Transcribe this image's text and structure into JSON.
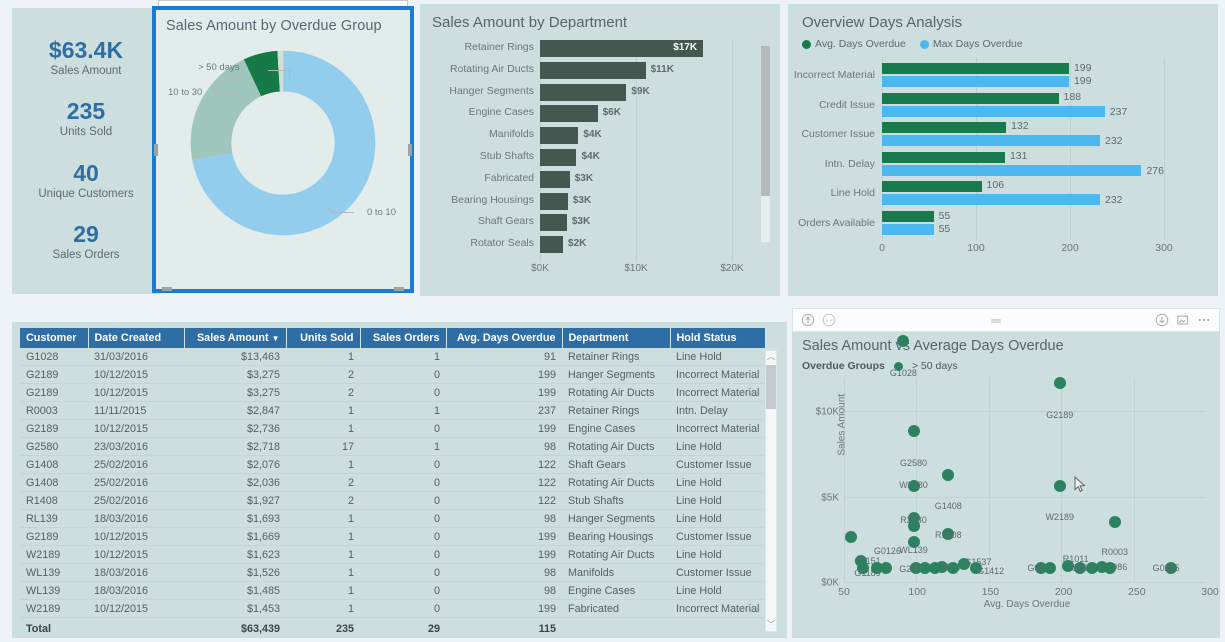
{
  "kpi": {
    "items": [
      {
        "value": "$63.4K",
        "label": "Sales Amount"
      },
      {
        "value": "235",
        "label": "Units Sold"
      },
      {
        "value": "40",
        "label": "Unique Customers"
      },
      {
        "value": "29",
        "label": "Sales Orders"
      }
    ]
  },
  "donut": {
    "title": "Sales Amount by Overdue Group",
    "labels": {
      "gt50": "> 50 days",
      "mid": "10 to 30",
      "low": "0 to 10"
    },
    "selected": true
  },
  "department": {
    "title": "Sales Amount by Department",
    "axis_ticks": [
      "$0K",
      "$10K",
      "$20K"
    ]
  },
  "overview": {
    "title": "Overview Days Analysis",
    "legend": [
      {
        "name": "Avg. Days Overdue",
        "color": "#187a4d"
      },
      {
        "name": "Max Days Overdue",
        "color": "#4bb8ef"
      }
    ],
    "axis_ticks": [
      "0",
      "100",
      "200",
      "300"
    ]
  },
  "table": {
    "columns": [
      "Customer",
      "Date Created",
      "Sales Amount",
      "Units Sold",
      "Sales Orders",
      "Avg. Days Overdue",
      "Department",
      "Hold Status"
    ],
    "sorted_column": "Sales Amount",
    "rows": [
      [
        "G1028",
        "31/03/2016",
        "$13,463",
        "1",
        "1",
        "91",
        "Retainer Rings",
        "Line Hold"
      ],
      [
        "G2189",
        "10/12/2015",
        "$3,275",
        "2",
        "0",
        "199",
        "Hanger Segments",
        "Incorrect Material"
      ],
      [
        "G2189",
        "10/12/2015",
        "$3,275",
        "2",
        "0",
        "199",
        "Rotating Air Ducts",
        "Incorrect Material"
      ],
      [
        "R0003",
        "11/11/2015",
        "$2,847",
        "1",
        "1",
        "237",
        "Retainer Rings",
        "Intn. Delay"
      ],
      [
        "G2189",
        "10/12/2015",
        "$2,736",
        "1",
        "0",
        "199",
        "Engine Cases",
        "Incorrect Material"
      ],
      [
        "G2580",
        "23/03/2016",
        "$2,718",
        "17",
        "1",
        "98",
        "Rotating Air Ducts",
        "Line Hold"
      ],
      [
        "G1408",
        "25/02/2016",
        "$2,076",
        "1",
        "0",
        "122",
        "Shaft Gears",
        "Customer Issue"
      ],
      [
        "G1408",
        "25/02/2016",
        "$2,036",
        "2",
        "0",
        "122",
        "Rotating Air Ducts",
        "Line Hold"
      ],
      [
        "R1408",
        "25/02/2016",
        "$1,927",
        "2",
        "0",
        "122",
        "Stub Shafts",
        "Line Hold"
      ],
      [
        "RL139",
        "18/03/2016",
        "$1,693",
        "1",
        "0",
        "98",
        "Hanger Segments",
        "Line Hold"
      ],
      [
        "G2189",
        "10/12/2015",
        "$1,669",
        "1",
        "0",
        "199",
        "Bearing Housings",
        "Customer Issue"
      ],
      [
        "W2189",
        "10/12/2015",
        "$1,623",
        "1",
        "0",
        "199",
        "Rotating Air Ducts",
        "Line Hold"
      ],
      [
        "WL139",
        "18/03/2016",
        "$1,526",
        "1",
        "0",
        "98",
        "Manifolds",
        "Customer Issue"
      ],
      [
        "WL139",
        "18/03/2016",
        "$1,485",
        "1",
        "0",
        "98",
        "Engine Cases",
        "Line Hold"
      ],
      [
        "W2189",
        "10/12/2015",
        "$1,453",
        "1",
        "0",
        "199",
        "Fabricated",
        "Incorrect Material"
      ]
    ],
    "total_row": [
      "Total",
      "",
      "$63,439",
      "235",
      "29",
      "115",
      "",
      ""
    ]
  },
  "scatter": {
    "title": "Sales Amount vs Average Days Overdue",
    "legend_label": "Overdue Groups",
    "legend_value": "> 50 days"
  },
  "chart_data": [
    {
      "type": "pie",
      "name": "donut-overdue-group",
      "title": "Sales Amount by Overdue Group",
      "categories": [
        "0 to 10",
        "10 to 30",
        "> 50 days"
      ],
      "values": [
        72,
        21,
        7
      ],
      "colors": [
        "#93cdee",
        "#9fc6ba",
        "#157a45"
      ],
      "legend": "labels-outside"
    },
    {
      "type": "bar",
      "name": "sales-amount-by-department",
      "title": "Sales Amount by Department",
      "orientation": "horizontal",
      "categories": [
        "Retainer Rings",
        "Rotating Air Ducts",
        "Hanger Segments",
        "Engine Cases",
        "Manifolds",
        "Stub Shafts",
        "Fabricated",
        "Bearing Housings",
        "Shaft Gears",
        "Rotator Seals"
      ],
      "values": [
        17,
        11,
        9,
        6,
        4,
        4,
        3,
        3,
        3,
        2
      ],
      "value_labels": [
        "$17K",
        "$11K",
        "$9K",
        "$6K",
        "$4K",
        "$4K",
        "$3K",
        "$3K",
        "$3K",
        "$2K"
      ],
      "xlabel": "",
      "ylabel": "",
      "xlim": [
        0,
        20
      ],
      "xtick_labels": [
        "$0K",
        "$10K",
        "$20K"
      ],
      "color": "#43584f",
      "grid": true
    },
    {
      "type": "bar",
      "name": "overview-days-analysis",
      "title": "Overview Days Analysis",
      "orientation": "horizontal",
      "categories": [
        "Incorrect Material",
        "Credit Issue",
        "Customer Issue",
        "Intn. Delay",
        "Line Hold",
        "Orders Available"
      ],
      "series": [
        {
          "name": "Avg. Days Overdue",
          "color": "#187a4d",
          "values": [
            199,
            188,
            132,
            131,
            106,
            55
          ]
        },
        {
          "name": "Max Days Overdue",
          "color": "#4bb8ef",
          "values": [
            199,
            237,
            232,
            276,
            232,
            55
          ]
        }
      ],
      "xlim": [
        0,
        300
      ],
      "xtick_labels": [
        "0",
        "100",
        "200",
        "300"
      ],
      "legend": "top-left",
      "grid": true
    },
    {
      "type": "scatter",
      "name": "sales-amount-vs-avg-days-overdue",
      "title": "Sales Amount vs Average Days Overdue",
      "xlabel": "Avg. Days Overdue",
      "ylabel": "Sales Amount",
      "xlim": [
        50,
        300
      ],
      "ylim": [
        0,
        12000
      ],
      "xtick_labels": [
        "50",
        "100",
        "150",
        "200",
        "250",
        "300"
      ],
      "ytick_labels": [
        "$0K",
        "$5K",
        "$10K"
      ],
      "series_name": "> 50 days",
      "color": "#2c8260",
      "points": [
        {
          "label": "G1028",
          "x": 91,
          "y": 13463
        },
        {
          "label": "G2189",
          "x": 199,
          "y": 11000
        },
        {
          "label": "G2580",
          "x": 98,
          "y": 8200
        },
        {
          "label": "G1408",
          "x": 122,
          "y": 5600
        },
        {
          "label": "W2580",
          "x": 98,
          "y": 5000
        },
        {
          "label": "W2189",
          "x": 199,
          "y": 5000
        },
        {
          "label": "R2580",
          "x": 98,
          "y": 3100
        },
        {
          "label": "R0003",
          "x": 237,
          "y": 2847
        },
        {
          "label": "R1408",
          "x": 122,
          "y": 2200
        },
        {
          "label": "G0126",
          "x": 55,
          "y": 2000
        },
        {
          "label": "WL139",
          "x": 98,
          "y": 1700
        },
        {
          "label": "G1151",
          "x": 62,
          "y": 600
        },
        {
          "label": "G1189",
          "x": 62,
          "y": 200
        },
        {
          "label": "G1537",
          "x": 133,
          "y": 400
        },
        {
          "label": "G2937",
          "x": 100,
          "y": 200
        },
        {
          "label": "G0026",
          "x": 118,
          "y": 250
        },
        {
          "label": "G1412",
          "x": 141,
          "y": 200
        },
        {
          "label": "G0005",
          "x": 186,
          "y": 200
        },
        {
          "label": "R1011",
          "x": 205,
          "y": 300
        },
        {
          "label": "G0094",
          "x": 213,
          "y": 200
        },
        {
          "label": "G2986",
          "x": 228,
          "y": 250
        },
        {
          "label": "G0205",
          "x": 276,
          "y": 150
        }
      ]
    }
  ]
}
